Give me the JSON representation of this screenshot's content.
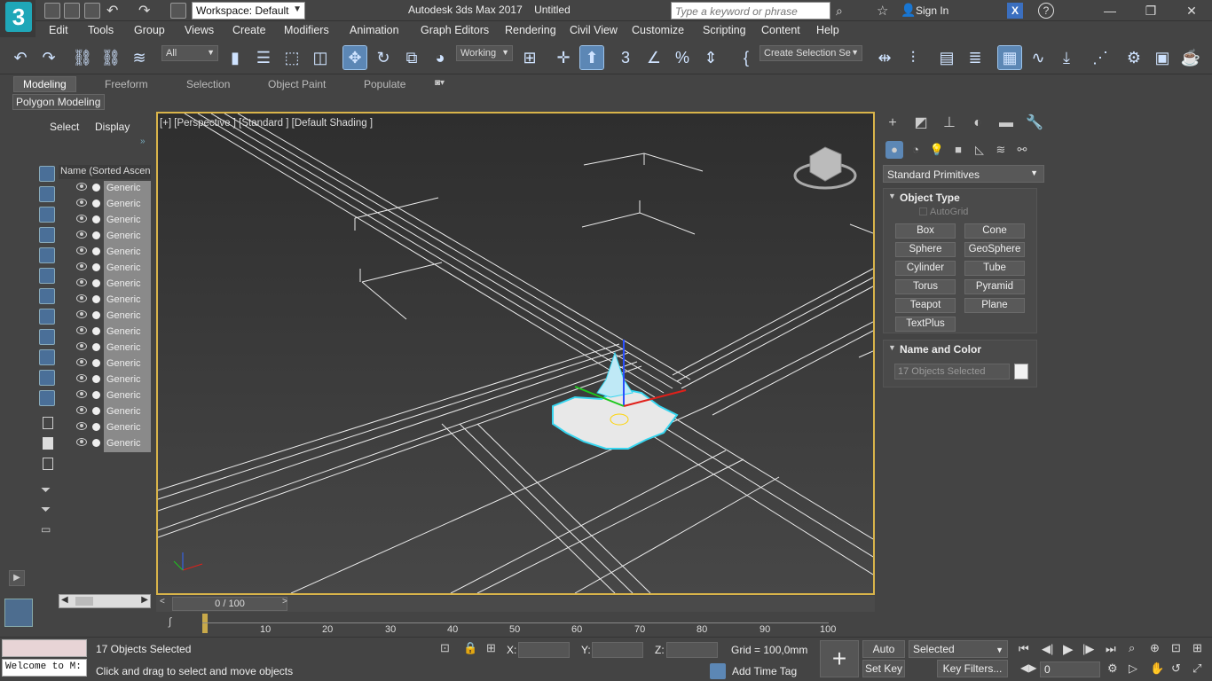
{
  "app": {
    "workspace": "Workspace: Default",
    "title": "Autodesk 3ds Max 2017",
    "document": "Untitled",
    "search_placeholder": "Type a keyword or phrase",
    "sign_in": "Sign In"
  },
  "menu": [
    "Edit",
    "Tools",
    "Group",
    "Views",
    "Create",
    "Modifiers",
    "Animation",
    "Graph Editors",
    "Rendering",
    "Civil View",
    "Customize",
    "Scripting",
    "Content",
    "Help"
  ],
  "toolbar": {
    "filter_value": "All",
    "ref_coord": "Working",
    "selection_set": "Create Selection Se"
  },
  "ribbon": {
    "tabs": [
      "Modeling",
      "Freeform",
      "Selection",
      "Object Paint",
      "Populate"
    ],
    "panel": "Polygon Modeling"
  },
  "scene_explorer": {
    "tabs": [
      "Select",
      "Display"
    ],
    "column_header": "Name (Sorted Ascending)",
    "items": [
      "Generic",
      "Generic",
      "Generic",
      "Generic",
      "Generic",
      "Generic",
      "Generic",
      "Generic",
      "Generic",
      "Generic",
      "Generic",
      "Generic",
      "Generic",
      "Generic",
      "Generic",
      "Generic",
      "Generic"
    ]
  },
  "viewport": {
    "label": "[+] [Perspective ] [Standard ] [Default Shading ]"
  },
  "timeline": {
    "frame": "0 / 100",
    "ticks": [
      "10",
      "20",
      "30",
      "40",
      "50",
      "60",
      "70",
      "80",
      "90",
      "100"
    ]
  },
  "command_panel": {
    "category": "Standard Primitives",
    "object_type_title": "Object Type",
    "autogrid": "AutoGrid",
    "buttons": [
      "Box",
      "Cone",
      "Sphere",
      "GeoSphere",
      "Cylinder",
      "Tube",
      "Torus",
      "Pyramid",
      "Teapot",
      "Plane",
      "TextPlus"
    ],
    "name_color_title": "Name and Color",
    "name_field": "17 Objects Selected"
  },
  "status": {
    "maxscript": "Welcome to M:",
    "selection": "17 Objects Selected",
    "prompt": "Click and drag to select and move objects",
    "x_label": "X:",
    "y_label": "Y:",
    "z_label": "Z:",
    "grid": "Grid = 100,0mm",
    "add_time_tag": "Add Time Tag",
    "auto_key": "Auto Key",
    "set_key": "Set Key",
    "key_mode": "Selected",
    "key_filters": "Key Filters...",
    "frame_value": "0"
  },
  "colors": {
    "accent": "#5c87b5",
    "viewport_border": "#d9b44a",
    "logo": "#1fa7b8"
  }
}
